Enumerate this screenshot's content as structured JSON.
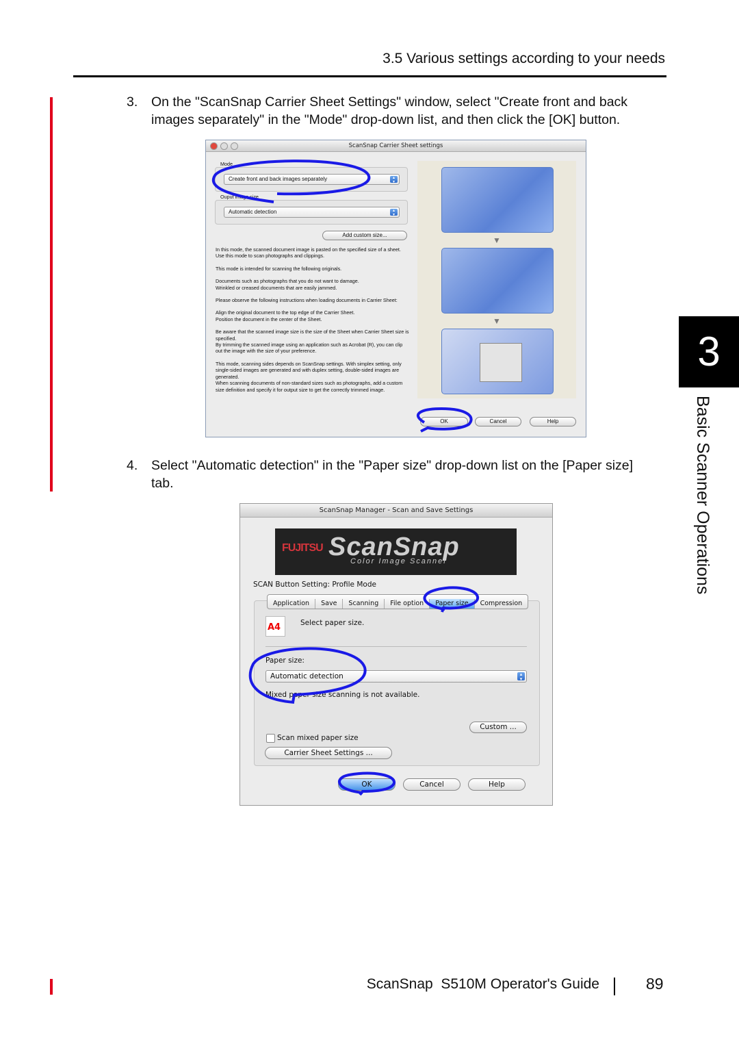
{
  "header": {
    "section": "3.5 Various settings according to your needs"
  },
  "steps": [
    {
      "num": "3.",
      "text": "On the \"ScanSnap Carrier Sheet Settings\" window, select \"Create front and back images separately\" in the \"Mode\" drop-down list, and then click the [OK] button."
    },
    {
      "num": "4.",
      "text": "Select \"Automatic detection\" in the \"Paper size\" drop-down list on the [Paper size] tab."
    }
  ],
  "dialog1": {
    "title": "ScanSnap Carrier Sheet settings",
    "mode_label": "Mode",
    "mode_value": "Create front and back images separately",
    "output_label": "Ouput image size",
    "output_value": "Automatic detection",
    "add_custom": "Add custom size...",
    "paragraphs": [
      "In this mode, the scanned document image is pasted on the specified size of a sheet.\nUse this mode to scan photographs and clippings.",
      "This mode is intended for scanning the following originals.",
      "Documents such as photographs that you do not want to damage.\n Wrinkled or creased documents that are easily jammed.",
      "Please observe the following instructions when loading documents in Carrier Sheet:",
      "Align the original document to the top edge of the Carrier Sheet.\nPosition the document in the center of the Sheet.",
      "Be aware that the scanned image size is the size of the Sheet when Carrier Sheet size is specified.\nBy trimming the scanned image using an application such as Acrobat (R), you can clip out the image with the size of your preference.",
      "This mode, scanning sides depends on ScanSnap settings. With simplex setting, only single-sided images are generated and with duplex setting, double-sided images are generated.\nWhen scanning documents of non-standard sizes such as photographs, add a custom size definition and specify it for output size to get the correctly trimmed image."
    ],
    "ok": "OK",
    "cancel": "Cancel",
    "help": "Help"
  },
  "dialog2": {
    "title": "ScanSnap Manager - Scan and Save Settings",
    "logo": {
      "brand": "FUJITSU",
      "product": "ScanSnap",
      "tagline": "Color Image Scanner"
    },
    "mode_line": "SCAN Button Setting: Profile Mode",
    "tabs": [
      "Application",
      "Save",
      "Scanning",
      "File option",
      "Paper size",
      "Compression"
    ],
    "active_tab": "Paper size",
    "icon_label": "A4",
    "instruction": "Select paper size.",
    "paper_label": "Paper size:",
    "paper_value": "Automatic detection",
    "mixed_note": "Mixed paper size scanning is not available.",
    "custom": "Custom ...",
    "scan_mixed": "Scan mixed paper size",
    "scan_mixed_checked": false,
    "carrier": "Carrier Sheet Settings ...",
    "ok": "OK",
    "cancel": "Cancel",
    "help": "Help"
  },
  "side_tab": {
    "chapter": "3",
    "title": "Basic Scanner Operations"
  },
  "footer": {
    "guide": "ScanSnap  S510M Operator's Guide",
    "page": "89"
  },
  "colors": {
    "accent_red": "#e0001b",
    "highlight_ring": "#1a1ae6"
  }
}
